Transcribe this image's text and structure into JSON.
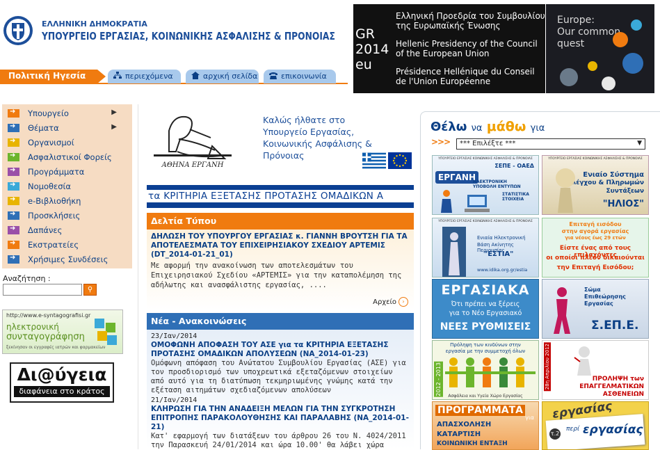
{
  "header": {
    "ministry_small": "ΕΛΛΗΝΙΚΗ ΔΗΜΟΚΡΑΤΙΑ",
    "ministry_big": "ΥΠΟΥΡΓΕΙΟ ΕΡΓΑΣΙΑΣ, ΚΟΙΝΩΝΙΚΗΣ ΑΣΦΑΛΙΣΗΣ & ΠΡΟΝΟΙΑΣ",
    "leadership_tab": "Πολιτική Ηγεσία",
    "buttons": {
      "contents": "περιεχόμενα",
      "home": "αρχική σελίδα",
      "contact": "επικοινωνία"
    },
    "gr2014": [
      "GR",
      "2014",
      "eu"
    ],
    "presidency": {
      "el": [
        "Ελληνική Προεδρία του Συμβουλίου",
        "της Ευρωπαϊκής Ένωσης"
      ],
      "en": [
        "Hellenic Presidency of the Council",
        "of the European Union"
      ],
      "fr": [
        "Présidence Hellénique du Conseil",
        "de l'Union Européenne"
      ]
    },
    "europe": [
      "Europe:",
      "Our common",
      "quest"
    ]
  },
  "nav": {
    "items": [
      {
        "label": "Υπουργείο",
        "color": "#f07b10",
        "sub": true
      },
      {
        "label": "Θέματα",
        "color": "#2f6fb6",
        "sub": true
      },
      {
        "label": "Οργανισμοί",
        "color": "#e8b400",
        "sub": false
      },
      {
        "label": "Ασφαλιστικοί Φορείς",
        "color": "#6cb52d",
        "sub": false
      },
      {
        "label": "Προγράμματα",
        "color": "#9a4fa8",
        "sub": false
      },
      {
        "label": "Νομοθεσία",
        "color": "#3aa9d8",
        "sub": false
      },
      {
        "label": "e-Βιβλιοθήκη",
        "color": "#e8b400",
        "sub": false
      },
      {
        "label": "Προσκλήσεις",
        "color": "#2f6fb6",
        "sub": false
      },
      {
        "label": "Δαπάνες",
        "color": "#9a4fa8",
        "sub": false
      },
      {
        "label": "Εκστρατείες",
        "color": "#f07b10",
        "sub": false
      },
      {
        "label": "Χρήσιμες Συνδέσεις",
        "color": "#2f6fb6",
        "sub": false
      }
    ]
  },
  "search": {
    "label": "Αναζήτηση :",
    "value": ""
  },
  "egov": {
    "url": "http://www.e-syntagografisi.gr",
    "line1": "ηλεκτρονική",
    "line2": "συνταγογράφηση",
    "line3": "ξεκίνησαν οι εγγραφές ιατρών και φαρμακείων"
  },
  "diavgeia": {
    "title": "Δι@ύγεια",
    "subtitle": "διαφάνεια στο κράτος"
  },
  "welcome": [
    "Καλώς ήλθατε στο",
    "Υπουργείο Εργασίας,",
    "Κοινωνικής Ασφάλισης & Πρόνοιας"
  ],
  "athena_caption": "ΑΘΗΝΑ ΕΡΓΑΝΗ",
  "marquee": "τα ΚΡΙΤΗΡΙΑ ΕΞΕΤΑΣΗΣ ΠΡΟΤΑΣΗΣ ΟΜΑΔΙΚΩΝ Α",
  "press": {
    "heading": "Δελτία Τύπου",
    "title": "ΔΗΛΩΣΗ ΤΟΥ ΥΠΟΥΡΓΟΥ ΕΡΓΑΣΙΑΣ κ. ΓΙΑΝΝΗ ΒΡΟΥΤΣΗ ΓΙΑ ΤΑ ΑΠΟΤΕΛΕΣΜΑΤΑ ΤΟΥ ΕΠΙΧΕΙΡΗΣΙΑΚΟΥ ΣΧΕΔΙΟΥ ΑΡΤΕΜΙΣ (DT_2014-01-21_01)",
    "body": "Με αφορμή την ανακοίνωση των αποτελεσμάτων του Επιχειρησιακού Σχεδίου «ΑΡΤΕΜΙΣ» για την καταπολέμηση της αδήλωτης και ανασφάλιστης εργασίας, ....",
    "archive": "Αρχείο"
  },
  "news": {
    "heading": "Νέα - Ανακοινώσεις",
    "items": [
      {
        "date": "23/Ιαν/2014",
        "title": "ΟΜΟΦΩΝΗ ΑΠΟΦΑΣΗ ΤΟΥ ΑΣΕ για τα ΚΡΙΤΗΡΙΑ ΕΞΕΤΑΣΗΣ ΠΡΟΤΑΣΗΣ ΟΜΑΔΙΚΩΝ ΑΠΟΛΥΣΕΩΝ (NA_2014-01-23)",
        "body": "Ομόφωνη απόφαση του Ανώτατου Συμβουλίου Εργασίας (ΑΣΕ) για τον προσδιορισμό των υποχρεωτικά εξεταζόμενων στοιχείων από αυτό για τη διατύπωση τεκμηριωμένης γνώμης κατά την εξέταση αιτημάτων σχεδιαζόμενων απολύσεων"
      },
      {
        "date": "21/Ιαν/2014",
        "title": "ΚΛΗΡΩΣΗ ΓΙΑ ΤΗΝ ΑΝΑΔΕΙΞΗ ΜΕΛΩΝ ΓΙΑ ΤΗΝ ΣΥΓΚΡΟΤΗΣΗ ΕΠΙΤΡΟΠΗΣ ΠΑΡΑΚΟΛΟΥΘΗΣΗΣ ΚΑΙ ΠΑΡΑΛΑΒΗΣ (NA_2014-01-21)",
        "body": "Κατ' εφαρμογή των διατάξεων του άρθρου 26 του Ν. 4024/2011 την Παρασκευή 24/01/2014 και ώρα 10.00' θα λάβει χώρα"
      }
    ]
  },
  "right": {
    "thelo": "Θέλω",
    "na": "να",
    "matho": "μάθω",
    "gia": "για",
    "select": "*** Επιλέξτε ***",
    "tiles": {
      "ergani_header": "ΥΠΟΥΡΓΕΙΟ ΕΡΓΑΣΙΑΣ ΚΟΙΝΩΝΙΚΗΣ ΑΣΦΑΛΙΣΗΣ & ΠΡΟΝΟΙΑΣ",
      "ergani_sepe": "ΣΕΠΕ - ΟΑΕΔ",
      "ergani_name": "ΕΡΓΑΝΗ",
      "ergani_sub1": "ΗΛΕΚΤΡΟΝΙΚΗ ΥΠΟΒΟΛΗ ΕΝΤΥΠΩΝ",
      "ergani_sub2": "ΣΤΑΤΙΣΤΙΚΑ ΣΤΟΙΧΕΙΑ",
      "helios_header": "ΥΠΟΥΡΓΕΙΟ ΕΡΓΑΣΙΑΣ ΚΟΙΝΩΝΙΚΗΣ ΑΣΦΑΛΙΣΗΣ & ΠΡΟΝΟΙΑΣ",
      "helios_l1": "Ενιαίο Σύστημα",
      "helios_l2": "Ελέγχου & Πληρωμών",
      "helios_l3": "Συντάξεων",
      "helios_name": "\"ΗΛΙΟΣ\"",
      "estia_header": "ΥΠΟΥΡΓΕΙΟ ΕΡΓΑΣΙΑΣ ΚΟΙΝΩΝΙΚΗΣ ΑΣΦΑΛΙΣΗΣ & ΠΡΟΝΟΙΑΣ",
      "estia_l1": "Ενιαία Ηλεκτρονική",
      "estia_l2": "Βάση Ακίνητης Περιουσίας",
      "estia_name": "\"ΕΣΤΙΑ\"",
      "estia_url": "www.idika.org.gr/estia",
      "entry_l1": "Επιταγή εισόδου",
      "entry_l2": "στην αγορά εργασίας",
      "entry_l3": "για νέους έως 29 ετών",
      "entry_l4": "Είστε ένας από τους επιλαχόντες",
      "entry_l5": "οι οποίοι πλέον δικαιούνται",
      "entry_l6": "την Επιταγή Εισόδου;",
      "ergasiaka_title": "ΕΡΓΑΣΙΑΚΑ",
      "ergasiaka_l1": "Ότι πρέπει να ξέρεις",
      "ergasiaka_l2": "για το Νέο Εργασιακό",
      "ergasiaka_l3": "ΝΕΕΣ ΡΥΘΜΙΣΕΙΣ",
      "sepe_l1": "Σώμα",
      "sepe_l2": "Επιθεώρησης",
      "sepe_l3": "Εργασίας",
      "sepe_name": "Σ.ΕΠ.Ε.",
      "prolipsi_l1": "Πρόληψη των κινδύνων στην",
      "prolipsi_l2": "εργασία με την συμμετοχή όλων",
      "prolipsi_year": "2012 - 2013",
      "prolipsi_footer": "Ασφάλεια και Υγεία Χώρο Εργασίας",
      "april_date": "28η Απριλίου 2012",
      "april_l1": "ΠΡΟΛΗΨΗ των",
      "april_l2": "ΕΠΑΓΓΕΛΜΑΤΙΚΩΝ",
      "april_l3": "ΑΣΘΕΝΕΙΩΝ",
      "prog_title": "ΠΡΟΓΡΑΜΜΑΤΑ",
      "prog_gia": "για",
      "prog_l1": "ΑΠΑΣΧΟΛΗΣΗ",
      "prog_l2": "ΚΑΤΑΡΤΙΣΗ",
      "prog_l3": "ΚΟΙΝΩΝΙΚΗ ΕΝΤΑΞΗ",
      "peri_num": "τ.2",
      "peri_small": "περί",
      "peri_big": "εργασίας",
      "peri_back": "εργασίας"
    }
  }
}
